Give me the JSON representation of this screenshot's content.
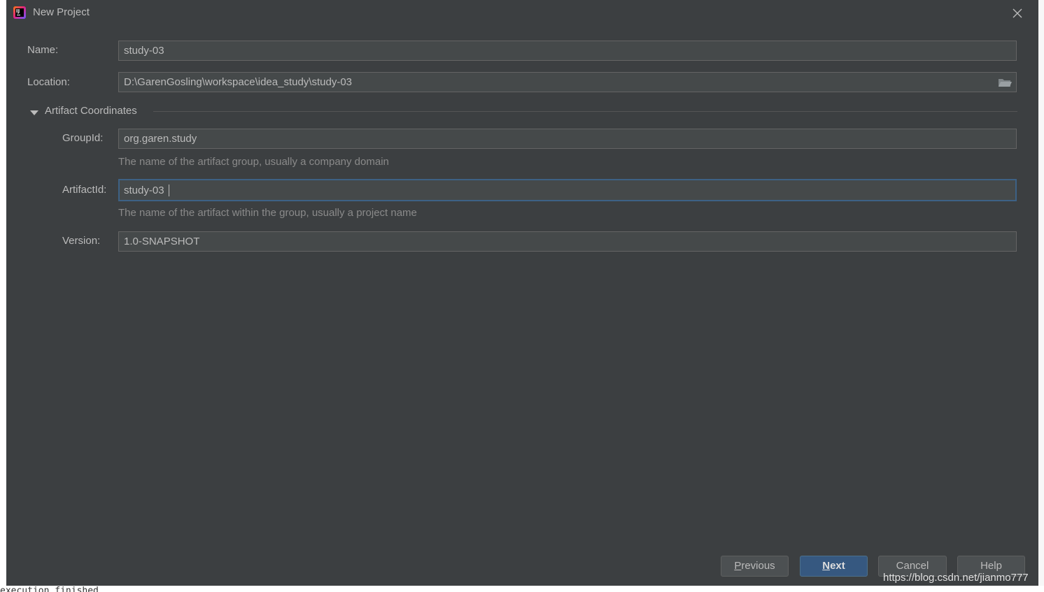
{
  "window": {
    "title": "New Project",
    "app_icon": "intellij-idea-icon",
    "close_icon": "close-icon"
  },
  "form": {
    "name": {
      "label": "Name:",
      "value": "study-03"
    },
    "location": {
      "label": "Location:",
      "value": "D:\\GarenGosling\\workspace\\idea_study\\study-03",
      "browse_icon": "folder-icon"
    },
    "artifact_coordinates": {
      "title": "Artifact Coordinates",
      "expanded": true,
      "group_id": {
        "label": "GroupId:",
        "value": "org.garen.study",
        "hint": "The name of the artifact group, usually a company domain"
      },
      "artifact_id": {
        "label": "ArtifactId:",
        "value": "study-03",
        "hint": "The name of the artifact within the group, usually a project name",
        "focused": true
      },
      "version": {
        "label": "Version:",
        "value": "1.0-SNAPSHOT"
      }
    }
  },
  "buttons": {
    "previous": {
      "mnemonic": "P",
      "rest": "revious"
    },
    "next": {
      "mnemonic": "N",
      "rest": "ext"
    },
    "cancel": "Cancel",
    "help": "Help"
  },
  "watermark": "https://blog.csdn.net/jianmo777",
  "background": {
    "bottom_text": "execution finished"
  },
  "colors": {
    "dialog_bg": "#3c3f41",
    "field_bg": "#45494a",
    "focus_border": "#3d6185",
    "primary_button": "#365880"
  }
}
